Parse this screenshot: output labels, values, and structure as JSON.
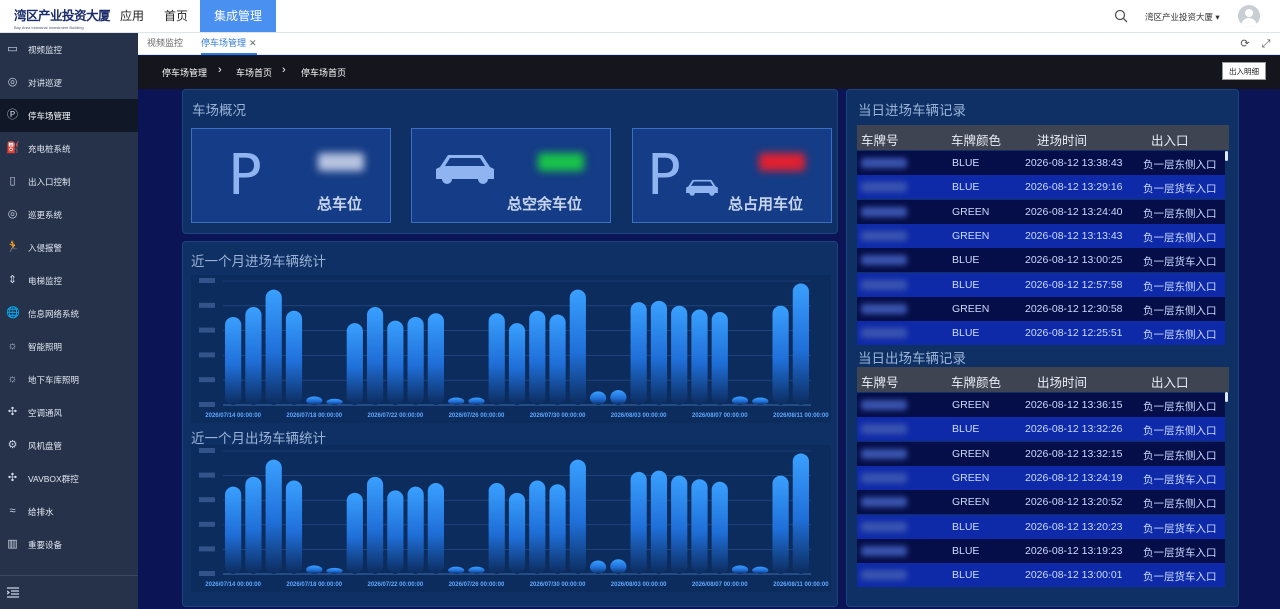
{
  "header": {
    "logo_text": "湾区产业投资大厦",
    "logo_sub": "Bay Area Industrial Investment Building",
    "nav": [
      {
        "label": "应用",
        "active": false
      },
      {
        "label": "首页",
        "active": false
      },
      {
        "label": "集成管理",
        "active": true
      }
    ],
    "org_name": "湾区产业投资大厦",
    "accent": "#4a90f0"
  },
  "sidebar": {
    "items": [
      {
        "label": "视频监控",
        "icon": "video-icon"
      },
      {
        "label": "对讲巡逻",
        "icon": "intercom-icon"
      },
      {
        "label": "停车场管理",
        "icon": "parking-icon",
        "active": true
      },
      {
        "label": "充电桩系统",
        "icon": "charger-icon"
      },
      {
        "label": "出入口控制",
        "icon": "door-icon"
      },
      {
        "label": "巡更系统",
        "icon": "patrol-icon"
      },
      {
        "label": "入侵报警",
        "icon": "intrusion-icon"
      },
      {
        "label": "电梯监控",
        "icon": "elevator-icon"
      },
      {
        "label": "信息网络系统",
        "icon": "globe-icon"
      },
      {
        "label": "智能照明",
        "icon": "bulb-icon"
      },
      {
        "label": "地下车库照明",
        "icon": "lamp-icon"
      },
      {
        "label": "空调通风",
        "icon": "fan-icon"
      },
      {
        "label": "风机盘管",
        "icon": "gear-icon"
      },
      {
        "label": "VAVBOX群控",
        "icon": "vav-icon"
      },
      {
        "label": "给排水",
        "icon": "water-icon"
      },
      {
        "label": "重要设备",
        "icon": "building-icon"
      }
    ],
    "collapse_icon": "menu-collapse-icon"
  },
  "tabs": [
    {
      "label": "视频监控",
      "active": false
    },
    {
      "label": "停车场管理",
      "active": true
    }
  ],
  "breadcrumb": [
    "停车场管理",
    "车场首页",
    "停车场首页"
  ],
  "io_button": "出入明细",
  "overview": {
    "title": "车场概况",
    "cards": [
      {
        "label": "总车位",
        "icon": "parking-p-icon",
        "value_color": "#b8c4e0"
      },
      {
        "label": "总空余车位",
        "icon": "car-icon",
        "value_color": "#18c24a"
      },
      {
        "label": "总占用车位",
        "icon": "parking-car-icon",
        "value_color": "#e02030"
      }
    ]
  },
  "entry_chart": {
    "title": "近一个月进场车辆统计",
    "x_labels": [
      "2026/07/14 00:00:00",
      "2026/07/18 00:00:00",
      "2026/07/22 00:00:00",
      "2026/07/26 00:00:00",
      "2026/07/30 00:00:00",
      "2026/08/03 00:00:00",
      "2026/08/07 00:00:00",
      "2026/08/11 00:00:00"
    ]
  },
  "exit_chart": {
    "title": "近一个月出场车辆统计",
    "x_labels": [
      "2026/07/14 00:00:00",
      "2026/07/18 00:00:00",
      "2026/07/22 00:00:00",
      "2026/07/26 00:00:00",
      "2026/07/30 00:00:00",
      "2026/08/03 00:00:00",
      "2026/08/07 00:00:00",
      "2026/08/11 00:00:00"
    ]
  },
  "chart_data": [
    {
      "type": "bar",
      "title": "近一个月进场车辆统计",
      "categories": [
        "2026/07/14",
        "2026/07/15",
        "2026/07/16",
        "2026/07/17",
        "2026/07/18",
        "2026/07/19",
        "2026/07/20",
        "2026/07/21",
        "2026/07/22",
        "2026/07/23",
        "2026/07/24",
        "2026/07/25",
        "2026/07/26",
        "2026/07/27",
        "2026/07/28",
        "2026/07/29",
        "2026/07/30",
        "2026/07/31",
        "2026/08/01",
        "2026/08/02",
        "2026/08/03",
        "2026/08/04",
        "2026/08/05",
        "2026/08/06",
        "2026/08/07",
        "2026/08/08",
        "2026/08/09",
        "2026/08/10",
        "2026/08/11",
        "2026/08/12"
      ],
      "values": [
        0.71,
        0.79,
        0.93,
        0.76,
        0.07,
        0.05,
        0.66,
        0.79,
        0.68,
        0.71,
        0.74,
        0.06,
        0.06,
        0.74,
        0.66,
        0.76,
        0.73,
        0.93,
        0.11,
        0.12,
        0.83,
        0.84,
        0.8,
        0.77,
        0.75,
        0.07,
        0.06,
        0.8,
        0.98
      ]
    },
    {
      "type": "bar",
      "title": "近一个月出场车辆统计",
      "categories": [
        "2026/07/14",
        "2026/07/15",
        "2026/07/16",
        "2026/07/17",
        "2026/07/18",
        "2026/07/19",
        "2026/07/20",
        "2026/07/21",
        "2026/07/22",
        "2026/07/23",
        "2026/07/24",
        "2026/07/25",
        "2026/07/26",
        "2026/07/27",
        "2026/07/28",
        "2026/07/29",
        "2026/07/30",
        "2026/07/31",
        "2026/08/01",
        "2026/08/02",
        "2026/08/03",
        "2026/08/04",
        "2026/08/05",
        "2026/08/06",
        "2026/08/07",
        "2026/08/08",
        "2026/08/09",
        "2026/08/10",
        "2026/08/11",
        "2026/08/12"
      ],
      "values": [
        0.71,
        0.79,
        0.93,
        0.76,
        0.07,
        0.05,
        0.66,
        0.79,
        0.68,
        0.71,
        0.74,
        0.06,
        0.06,
        0.74,
        0.66,
        0.76,
        0.73,
        0.93,
        0.11,
        0.12,
        0.83,
        0.84,
        0.8,
        0.77,
        0.75,
        0.07,
        0.06,
        0.8,
        0.98
      ]
    }
  ],
  "entry_records": {
    "title": "当日进场车辆记录",
    "columns": [
      "车牌号",
      "车牌颜色",
      "进场时间",
      "出入口"
    ],
    "rows": [
      {
        "color": "BLUE",
        "time": "2026-08-12 13:38:43",
        "gate": "负一层东侧入口"
      },
      {
        "color": "BLUE",
        "time": "2026-08-12 13:29:16",
        "gate": "负一层货车入口"
      },
      {
        "color": "GREEN",
        "time": "2026-08-12 13:24:40",
        "gate": "负一层东侧入口"
      },
      {
        "color": "GREEN",
        "time": "2026-08-12 13:13:43",
        "gate": "负一层东侧入口"
      },
      {
        "color": "BLUE",
        "time": "2026-08-12 13:00:25",
        "gate": "负一层货车入口"
      },
      {
        "color": "BLUE",
        "time": "2026-08-12 12:57:58",
        "gate": "负一层东侧入口"
      },
      {
        "color": "GREEN",
        "time": "2026-08-12 12:30:58",
        "gate": "负一层东侧入口"
      },
      {
        "color": "BLUE",
        "time": "2026-08-12 12:25:51",
        "gate": "负一层东侧入口"
      }
    ]
  },
  "exit_records": {
    "title": "当日出场车辆记录",
    "columns": [
      "车牌号",
      "车牌颜色",
      "出场时间",
      "出入口"
    ],
    "rows": [
      {
        "color": "GREEN",
        "time": "2026-08-12 13:36:15",
        "gate": "负一层东侧入口"
      },
      {
        "color": "BLUE",
        "time": "2026-08-12 13:32:26",
        "gate": "负一层东侧入口"
      },
      {
        "color": "GREEN",
        "time": "2026-08-12 13:32:15",
        "gate": "负一层东侧入口"
      },
      {
        "color": "GREEN",
        "time": "2026-08-12 13:24:19",
        "gate": "负一层货车入口"
      },
      {
        "color": "GREEN",
        "time": "2026-08-12 13:20:52",
        "gate": "负一层东侧入口"
      },
      {
        "color": "BLUE",
        "time": "2026-08-12 13:20:23",
        "gate": "负一层货车入口"
      },
      {
        "color": "BLUE",
        "time": "2026-08-12 13:19:23",
        "gate": "负一层货车入口"
      },
      {
        "color": "BLUE",
        "time": "2026-08-12 13:00:01",
        "gate": "负一层货车入口"
      }
    ]
  }
}
